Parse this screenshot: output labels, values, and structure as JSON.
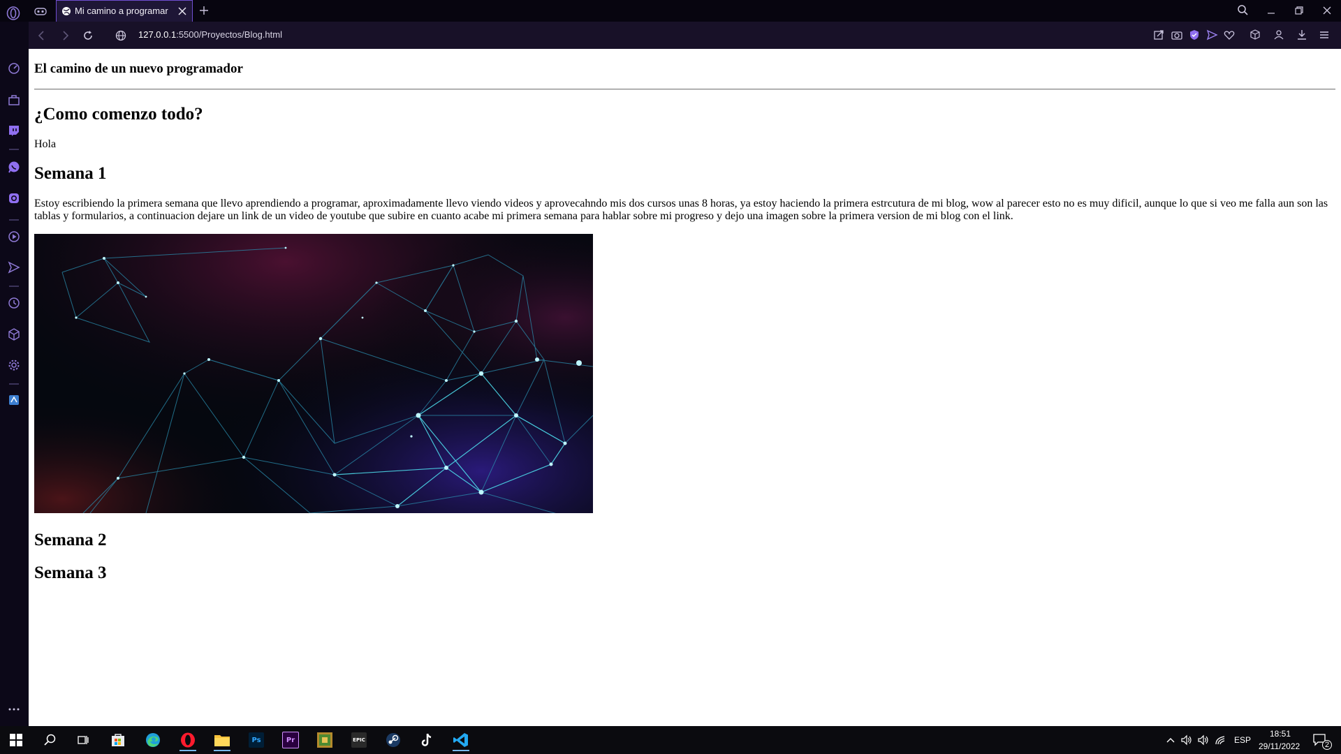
{
  "browser": {
    "tab_title": "Mi camino a programar",
    "url_host": "127.0.0.1",
    "url_rest": ":5500/Proyectos/Blog.html",
    "accent": "#6f4ed0"
  },
  "sidebar": {
    "items": [
      "speed-dial-icon",
      "bag-icon",
      "twitch-icon",
      "whatsapp-icon",
      "instagram-icon",
      "player-icon",
      "send-icon",
      "history-icon",
      "box-icon",
      "settings-icon",
      "app-icon"
    ]
  },
  "page": {
    "site_title": "El camino de un nuevo programador",
    "section1_title": "¿Como comenzo todo?",
    "section1_text": "Hola",
    "week1_title": "Semana 1",
    "week1_text": "Estoy escribiendo la primera semana que llevo aprendiendo a programar, aproximadamente llevo viendo videos y aprovecahndo mis dos cursos unas 8 horas, ya estoy haciendo la primera estrcutura de mi blog, wow al parecer esto no es muy dificil, aunque lo que si veo me falla aun son las tablas y formularios, a continuacion dejare un link de un video de youtube que subire en cuanto acabe mi primera semana para hablar sobre mi progreso y dejo una imagen sobre la primera version de mi blog con el link.",
    "week2_title": "Semana 2",
    "week3_title": "Semana 3"
  },
  "taskbar": {
    "apps": [
      "start",
      "search",
      "task-view",
      "store",
      "edge",
      "opera",
      "file-explorer",
      "photoshop",
      "premiere",
      "minecraft",
      "epic-games",
      "steam",
      "tiktok",
      "vscode"
    ],
    "ps_label": "Ps",
    "pr_label": "Pr",
    "epic_label": "EPIC",
    "language": "ESP",
    "time": "18:51",
    "date": "29/11/2022",
    "notifications": "2"
  }
}
